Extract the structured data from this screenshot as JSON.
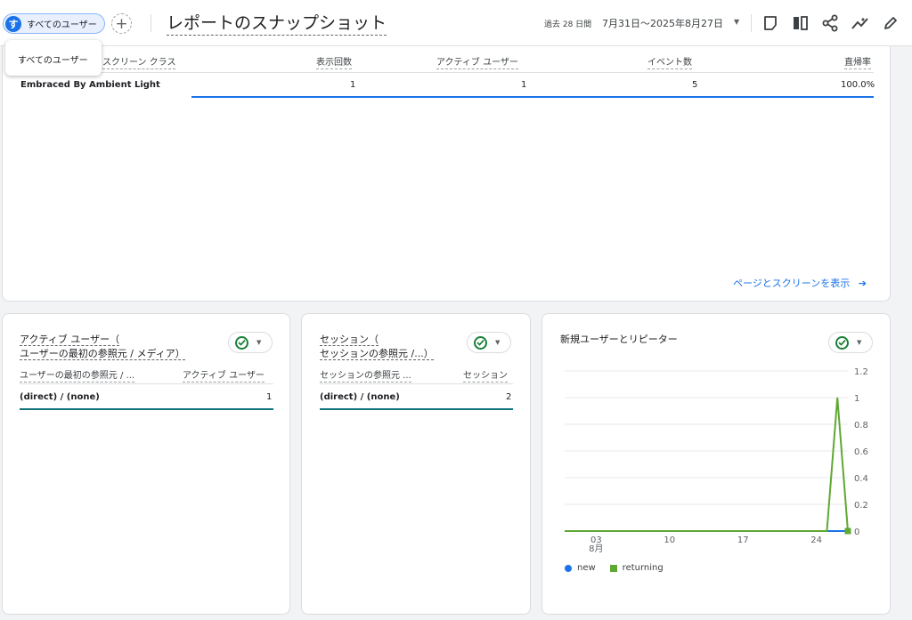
{
  "header": {
    "segment_chip": {
      "avatar": "す",
      "label": "すべてのユーザー"
    },
    "add_label": "+",
    "title": "レポートのスナップショット",
    "date_prefix": "過去 28 日間",
    "date_range": "7月31日～2025年8月27日",
    "toolbar_icons": [
      "comment-icon",
      "compare-icon",
      "share-icon",
      "insights-icon",
      "edit-icon"
    ]
  },
  "tooltip": {
    "text": "すべてのユーザー"
  },
  "pages_table": {
    "columns": [
      "スクリーン クラス",
      "表示回数",
      "アクティブ ユーザー",
      "イベント数",
      "直帰率"
    ],
    "rows": [
      {
        "name": "Embraced By Ambient Light",
        "views": "1",
        "active_users": "1",
        "events": "5",
        "bounce": "100.0%"
      }
    ],
    "link": "ページとスクリーンを表示"
  },
  "card_active_users": {
    "title_line1": "アクティブ ユーザー（",
    "title_line2": "ユーザーの最初の参照元 / メディア）",
    "col1": "ユーザーの最初の参照元 / ...",
    "col2": "アクティブ ユーザー",
    "row": {
      "label": "(direct) / (none)",
      "value": "1"
    }
  },
  "card_sessions": {
    "title_line1": "セッション（",
    "title_line2": "セッションの参照元 /...）",
    "col1": "セッションの参照元 ...",
    "col2": "セッション",
    "row": {
      "label": "(direct) / (none)",
      "value": "2"
    }
  },
  "card_new_returning": {
    "title": "新規ユーザーとリピーター",
    "legend": [
      "new",
      "returning"
    ]
  },
  "colors": {
    "accent": "#1a73e8",
    "check": "#188038",
    "returning": "#5fa833",
    "teal": "#12737c"
  },
  "chart_data": {
    "type": "line",
    "x": [
      "07-31",
      "08-01",
      "08-02",
      "08-03",
      "08-04",
      "08-05",
      "08-06",
      "08-07",
      "08-08",
      "08-09",
      "08-10",
      "08-11",
      "08-12",
      "08-13",
      "08-14",
      "08-15",
      "08-16",
      "08-17",
      "08-18",
      "08-19",
      "08-20",
      "08-21",
      "08-22",
      "08-23",
      "08-24",
      "08-25",
      "08-26",
      "08-27"
    ],
    "x_tick_labels": [
      "03\n8月",
      "10",
      "17",
      "24"
    ],
    "x_tick_dates": [
      "08-03",
      "08-10",
      "08-17",
      "08-24"
    ],
    "series": [
      {
        "name": "new",
        "values": [
          0,
          0,
          0,
          0,
          0,
          0,
          0,
          0,
          0,
          0,
          0,
          0,
          0,
          0,
          0,
          0,
          0,
          0,
          0,
          0,
          0,
          0,
          0,
          0,
          0,
          0,
          0,
          0
        ]
      },
      {
        "name": "returning",
        "values": [
          0,
          0,
          0,
          0,
          0,
          0,
          0,
          0,
          0,
          0,
          0,
          0,
          0,
          0,
          0,
          0,
          0,
          0,
          0,
          0,
          0,
          0,
          0,
          0,
          0,
          0,
          1,
          0
        ]
      }
    ],
    "ylim": [
      0,
      1.2
    ],
    "y_ticks": [
      "0",
      "0.2",
      "0.4",
      "0.6",
      "0.8",
      "1",
      "1.2"
    ],
    "grid": true,
    "legend_position": "bottom-left"
  }
}
